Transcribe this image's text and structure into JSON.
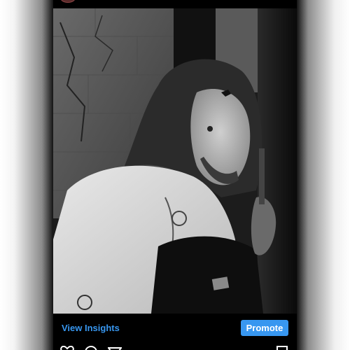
{
  "post": {
    "photo_description_icon": "photo",
    "insights_label": "View Insights",
    "promote_label": "Promote"
  },
  "icons": {
    "like": "heart-icon",
    "comment": "comment-icon",
    "share": "send-icon",
    "save": "bookmark-icon"
  },
  "colors": {
    "accent": "#3897f0",
    "background": "#000000"
  }
}
